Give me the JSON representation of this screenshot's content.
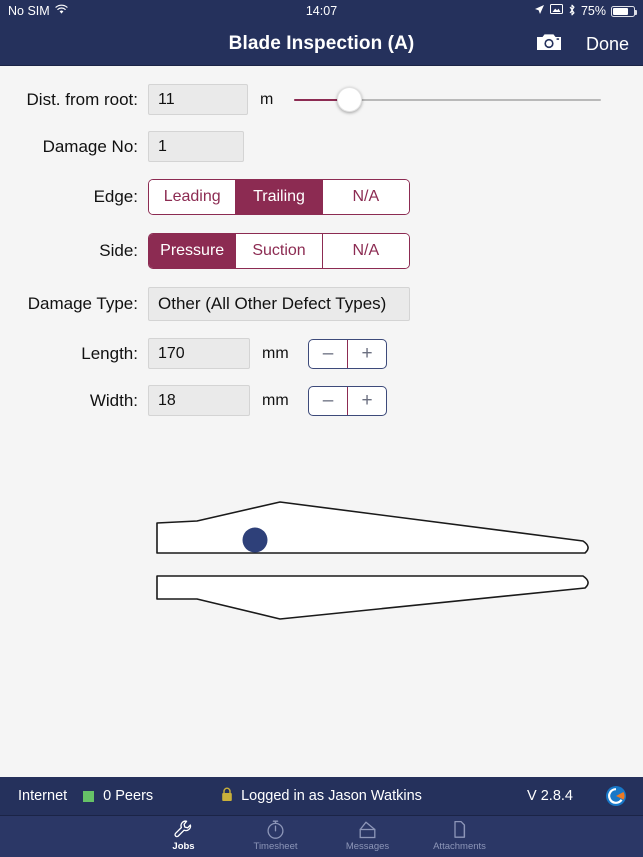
{
  "status_bar": {
    "carrier": "No SIM",
    "wifi_icon": "wifi-icon",
    "time": "14:07",
    "location_icon": "location-arrow-icon",
    "airplay_icon": "screen-mirroring-icon",
    "bluetooth_icon": "bluetooth-icon",
    "battery_percent": "75%",
    "battery_level": 75
  },
  "nav": {
    "title": "Blade Inspection (A)",
    "camera_icon": "camera-icon",
    "done_label": "Done"
  },
  "form": {
    "dist_from_root": {
      "label": "Dist. from root:",
      "value": "11",
      "unit": "m",
      "slider_position_percent": 18
    },
    "damage_no": {
      "label": "Damage No:",
      "value": "1"
    },
    "edge": {
      "label": "Edge:",
      "options": [
        "Leading",
        "Trailing",
        "N/A"
      ],
      "selected": "Trailing"
    },
    "side": {
      "label": "Side:",
      "options": [
        "Pressure",
        "Suction",
        "N/A"
      ],
      "selected": "Pressure"
    },
    "damage_type": {
      "label": "Damage Type:",
      "value": "Other (All Other Defect Types)"
    },
    "length": {
      "label": "Length:",
      "value": "170",
      "unit": "mm",
      "minus": "–",
      "plus": "+"
    },
    "width": {
      "label": "Width:",
      "value": "18",
      "unit": "mm",
      "minus": "–",
      "plus": "+"
    }
  },
  "diagram": {
    "name": "blade-profile-diagram",
    "damage_marker_color": "#2e4079",
    "outline_color": "#1a1a1a"
  },
  "bottom_status": {
    "connection": "Internet",
    "peers": "0 Peers",
    "lock_icon": "lock-icon",
    "login": "Logged in as Jason Watkins",
    "version": "V 2.8.4",
    "logo_icon": "app-logo-icon"
  },
  "tabs": [
    {
      "label": "Jobs",
      "icon": "wrench-icon",
      "active": true
    },
    {
      "label": "Timesheet",
      "icon": "stopwatch-icon",
      "active": false
    },
    {
      "label": "Messages",
      "icon": "inbox-icon",
      "active": false
    },
    {
      "label": "Attachments",
      "icon": "documents-icon",
      "active": false
    }
  ],
  "colors": {
    "navy": "#25315c",
    "maroon": "#8c2b52",
    "background": "#f5f5f5",
    "field": "#eaeaea"
  }
}
